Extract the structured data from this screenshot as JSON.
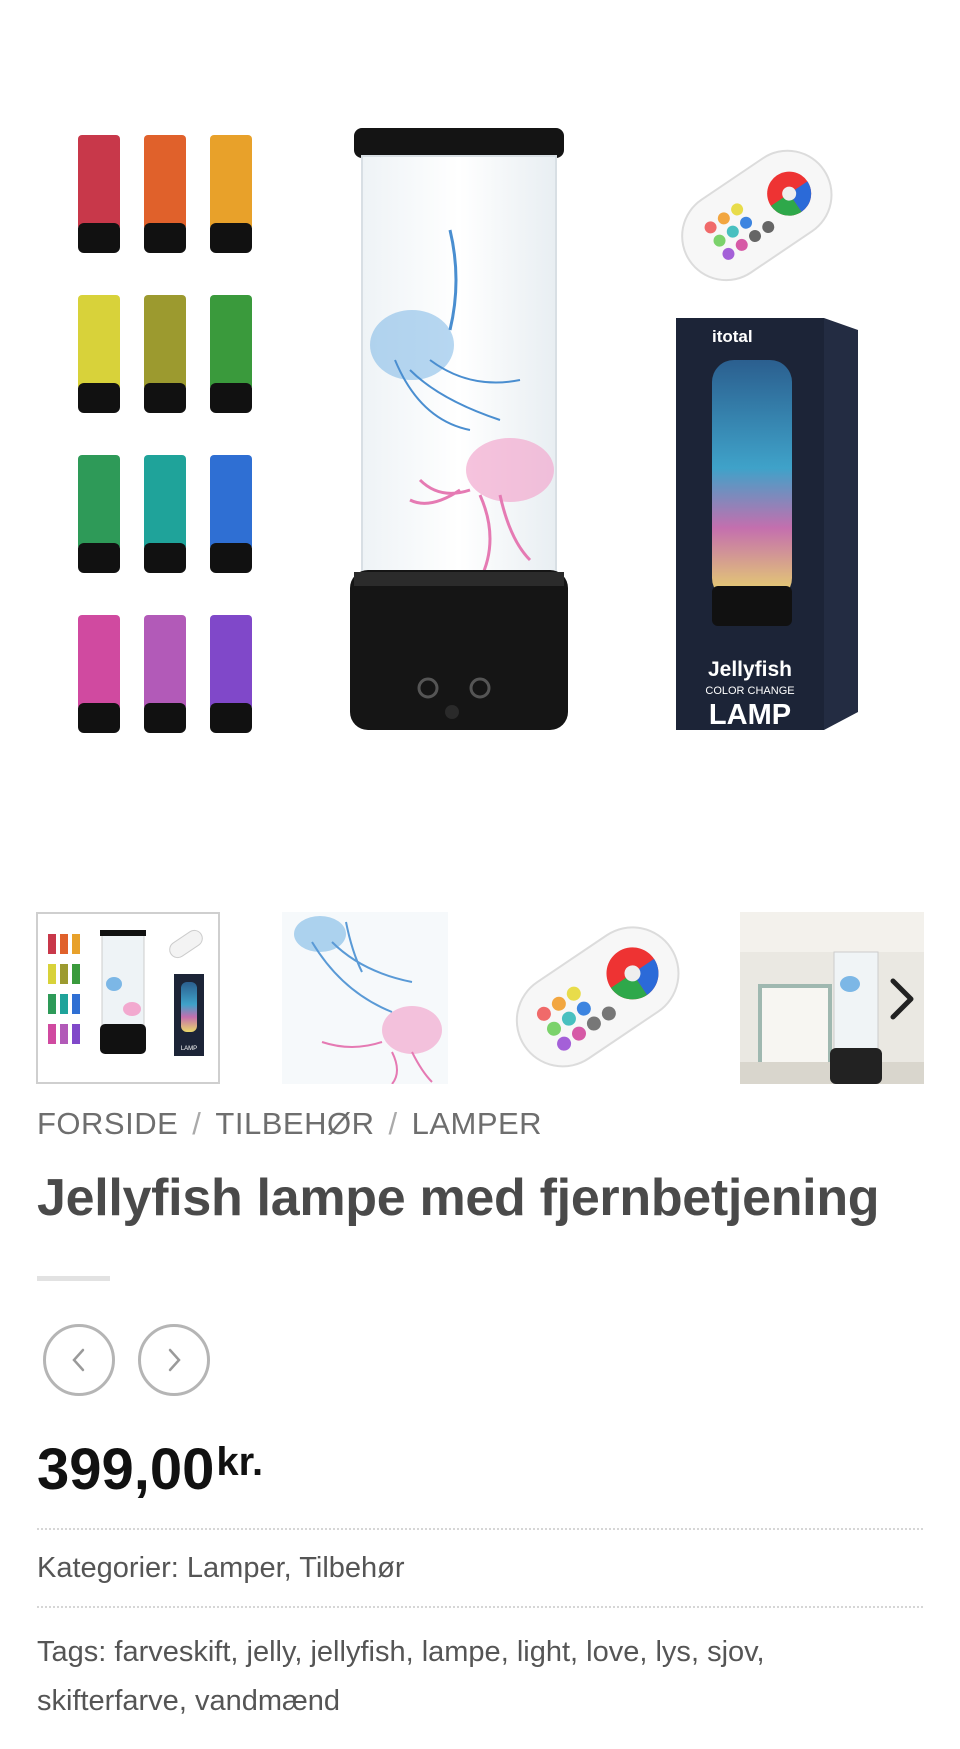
{
  "product": {
    "image_alt": "Jellyfish lamp product image",
    "box_brand": "itotal",
    "box_name": "Jellyfish",
    "box_subtitle": "COLOR CHANGE",
    "box_type": "LAMP",
    "box_thumb_label": "LAMP"
  },
  "thumbnails": [
    {
      "name": "thumbnail-product-overview",
      "selected": true
    },
    {
      "name": "thumbnail-jellyfish-closeup",
      "selected": false
    },
    {
      "name": "thumbnail-remote-control",
      "selected": false
    },
    {
      "name": "thumbnail-lamp-in-room",
      "selected": false
    }
  ],
  "icons": {
    "thumb_next": "chevron-right-icon",
    "prev": "chevron-left-icon",
    "next": "chevron-right-icon"
  },
  "breadcrumb": {
    "items": [
      "FORSIDE",
      "TILBEHØR",
      "LAMPER"
    ],
    "separator": "/"
  },
  "title": "Jellyfish lampe med fjernbetjening",
  "price": {
    "amount": "399,00",
    "currency": "kr."
  },
  "categories": {
    "label": "Kategorier:",
    "items": [
      "Lamper",
      "Tilbehør"
    ]
  },
  "tags": {
    "label": "Tags:",
    "items": [
      "farveskift",
      "jelly",
      "jellyfish",
      "lampe",
      "light",
      "love",
      "lys",
      "sjov",
      "skifterfarve",
      "vandmænd"
    ]
  },
  "colors": {
    "title": "#4a4a4a",
    "breadcrumb": "#6e6e6e",
    "price": "#111111",
    "box_bg": "#1c2437"
  }
}
